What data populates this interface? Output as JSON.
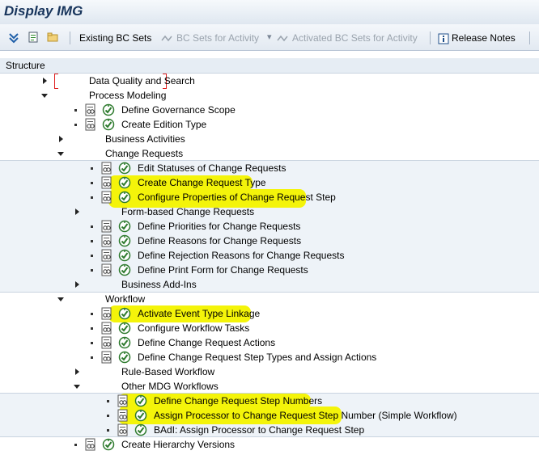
{
  "window": {
    "title": "Display IMG"
  },
  "toolbar": {
    "existing_bc_sets": "Existing BC Sets",
    "bc_sets_for_activity": "BC Sets for Activity",
    "activated_bc_sets_for_activity": "Activated BC Sets for Activity",
    "release_notes": "Release Notes"
  },
  "structure": {
    "header": "Structure",
    "nodes": [
      {
        "label": "Data Quality and Search",
        "type": "folder",
        "expanded": false
      },
      {
        "label": "Process Modeling",
        "type": "folder",
        "expanded": true
      },
      {
        "label": "Define Governance Scope",
        "type": "activity"
      },
      {
        "label": "Create Edition Type",
        "type": "activity"
      },
      {
        "label": "Business Activities",
        "type": "folder",
        "expanded": false
      },
      {
        "label": "Change Requests",
        "type": "folder",
        "expanded": true
      },
      {
        "label": "Edit Statuses of Change Requests",
        "type": "activity"
      },
      {
        "label": "Create Change Request Type",
        "type": "activity",
        "highlighted": true
      },
      {
        "label": "Configure Properties of Change Request Step",
        "type": "activity",
        "highlighted": true
      },
      {
        "label": "Form-based Change Requests",
        "type": "folder",
        "expanded": false
      },
      {
        "label": "Define Priorities for Change Requests",
        "type": "activity"
      },
      {
        "label": "Define Reasons for Change Requests",
        "type": "activity"
      },
      {
        "label": "Define Rejection Reasons for Change Requests",
        "type": "activity"
      },
      {
        "label": "Define Print Form for Change Requests",
        "type": "activity"
      },
      {
        "label": "Business Add-Ins",
        "type": "folder",
        "expanded": false
      },
      {
        "label": "Workflow",
        "type": "folder",
        "expanded": true
      },
      {
        "label": "Activate Event Type Linkage",
        "type": "activity",
        "highlighted": true
      },
      {
        "label": "Configure Workflow Tasks",
        "type": "activity"
      },
      {
        "label": "Define Change Request Actions",
        "type": "activity"
      },
      {
        "label": "Define Change Request Step Types and Assign Actions",
        "type": "activity"
      },
      {
        "label": "Rule-Based Workflow",
        "type": "folder",
        "expanded": false
      },
      {
        "label": "Other MDG Workflows",
        "type": "folder",
        "expanded": true
      },
      {
        "label": "Define Change Request Step Numbers",
        "type": "activity",
        "highlighted": true
      },
      {
        "label": "Assign Processor to Change Request Step Number (Simple Workflow)",
        "type": "activity",
        "highlighted": true
      },
      {
        "label": "BAdI: Assign Processor to Change Request Step",
        "type": "activity"
      },
      {
        "label": "Create Hierarchy Versions",
        "type": "activity"
      }
    ]
  },
  "colors": {
    "highlight": "#f4f40a",
    "title": "#18355c",
    "band": "#eef3f8"
  }
}
